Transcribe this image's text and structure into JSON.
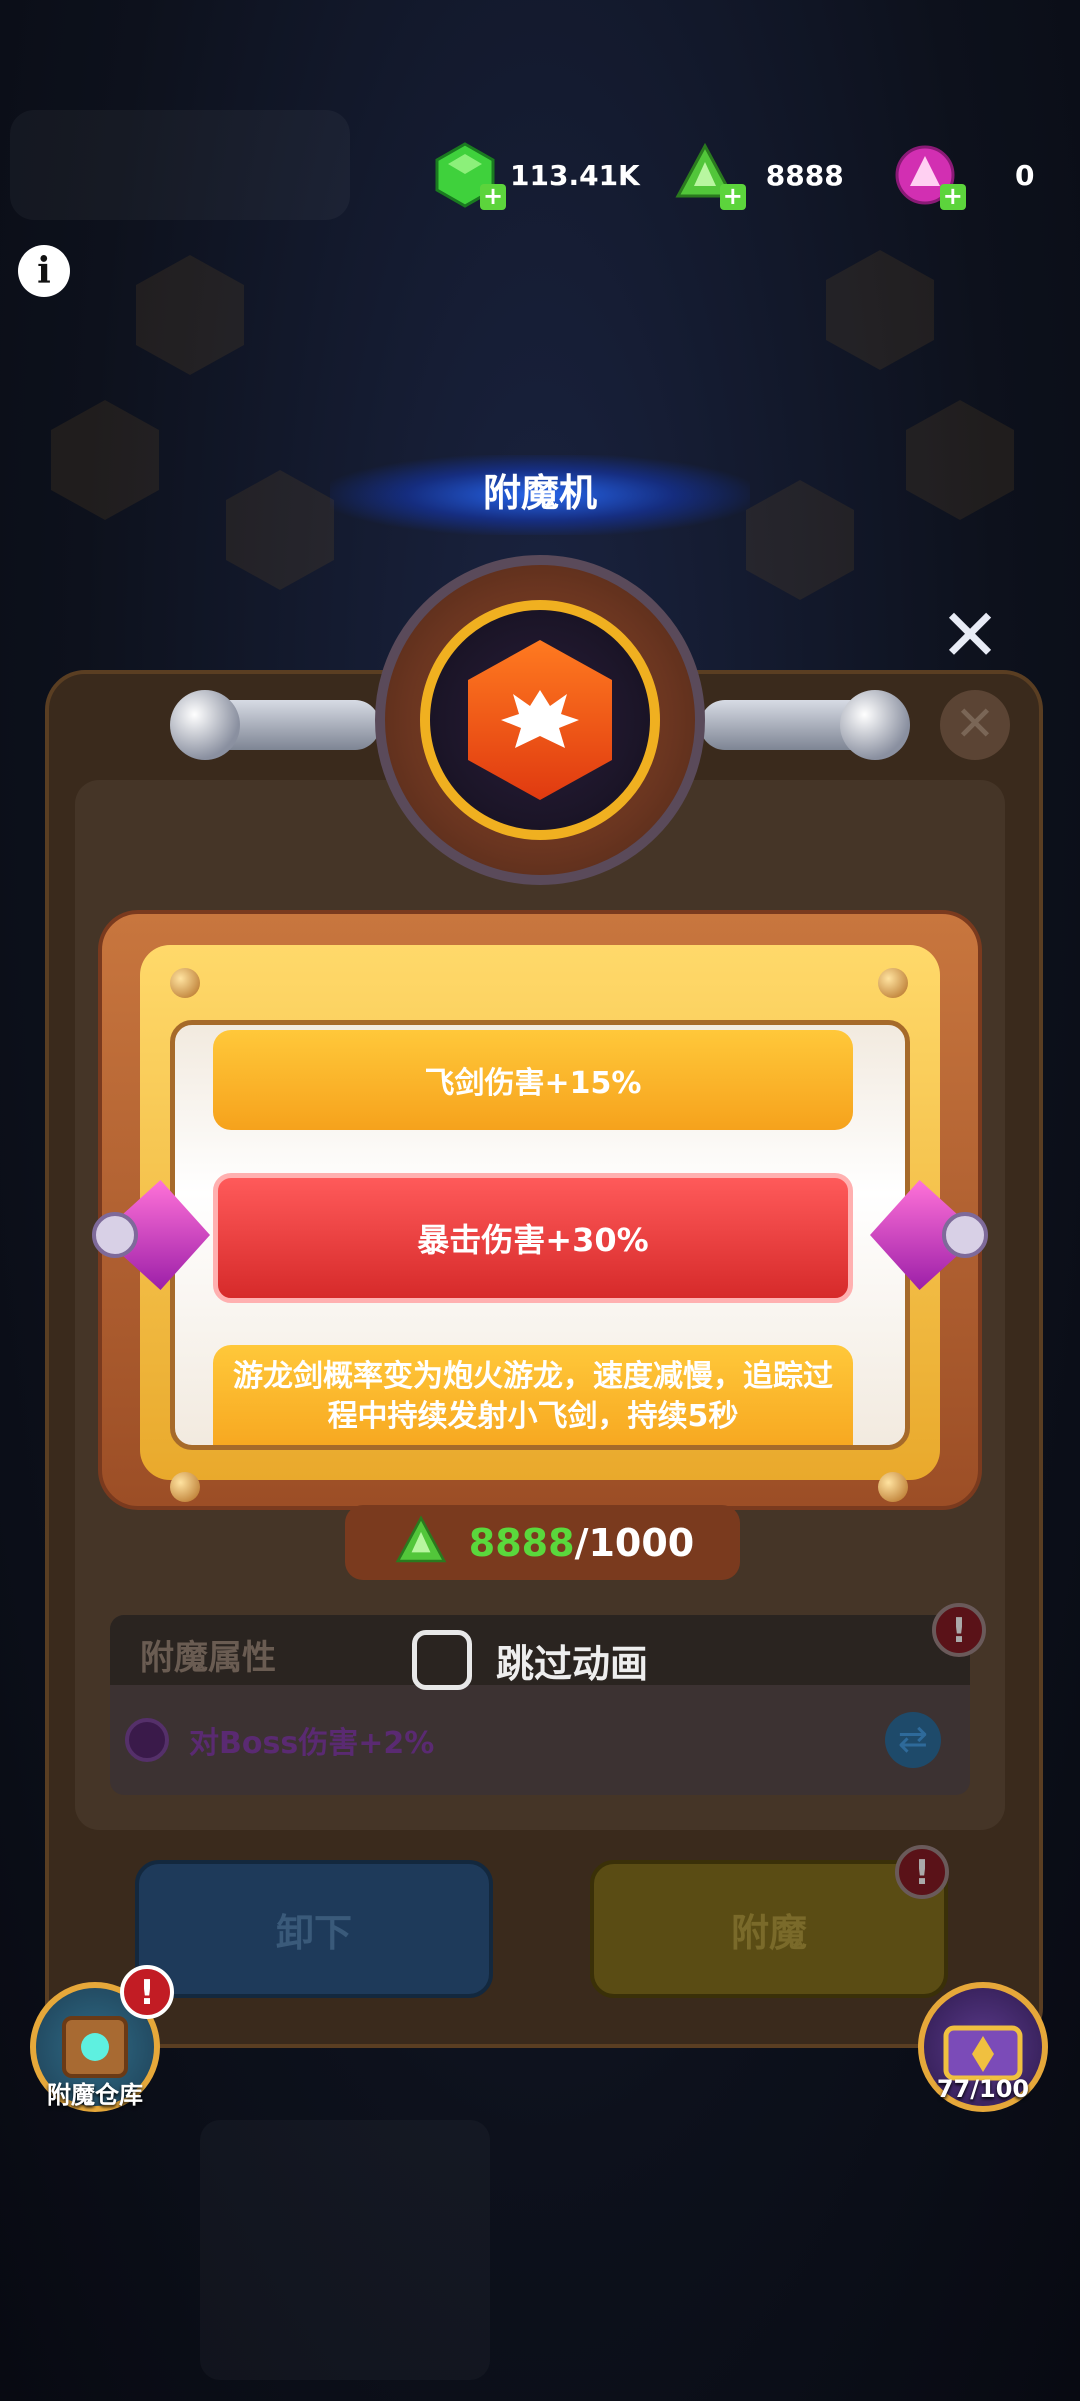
{
  "header": {
    "currencies": [
      {
        "icon": "green-gem-icon",
        "value": "113.41K"
      },
      {
        "icon": "green-crystal-icon",
        "value": "8888"
      },
      {
        "icon": "pink-crystal-icon",
        "value": "0"
      }
    ]
  },
  "dialog": {
    "title": "附魔机",
    "reel": {
      "top": "飞剑伤害+15%",
      "selected": "暴击伤害+30%",
      "bottom": "游龙剑概率变为炮火游龙，速度减慢，追踪过程中持续发射小飞剑，持续5秒"
    },
    "cost": {
      "have": "8888",
      "need": "/1000"
    },
    "skip_label": "跳过动画",
    "attr_title": "附魔属性",
    "attr_value": "对Boss伤害+2%",
    "unequip_label": "卸下",
    "enchant_label": "附魔"
  },
  "corner": {
    "storage_label": "附魔仓库",
    "chest_label": "77/100",
    "badge": "!"
  },
  "colors": {
    "accent_gold": "#f0b020",
    "reel_selected": "#d62a2a",
    "reel_option": "#f6a21c",
    "cost_have": "#5ad83c",
    "badge_red": "#c21c24"
  }
}
